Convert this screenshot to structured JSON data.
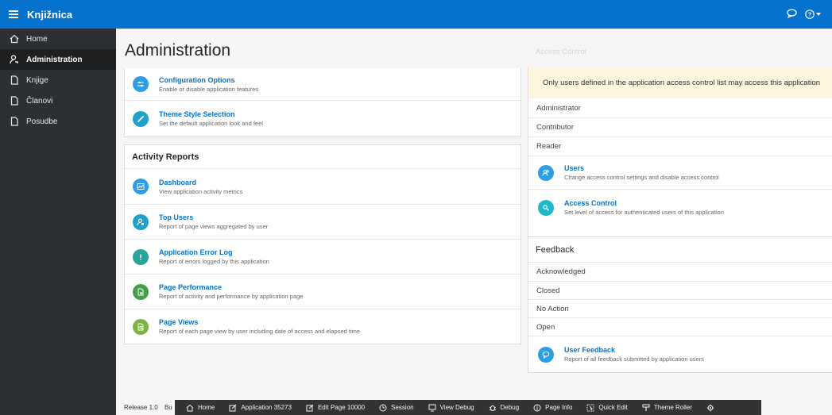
{
  "header": {
    "app_title": "Knjižnica",
    "menu_icon": "hamburger-icon",
    "chat_icon": "speech-bubble-icon",
    "help_icon": "help-icon"
  },
  "sidebar": {
    "items": [
      {
        "label": "Home",
        "icon": "home-icon"
      },
      {
        "label": "Administration",
        "icon": "user-key-icon"
      },
      {
        "label": "Knjige",
        "icon": "page-icon"
      },
      {
        "label": "Članovi",
        "icon": "page-icon"
      },
      {
        "label": "Posudbe",
        "icon": "page-icon"
      }
    ]
  },
  "main": {
    "page_title": "Administration",
    "settings_panel": {
      "items": [
        {
          "title": "Configuration Options",
          "desc": "Enable or disable application features",
          "icon": "sliders-icon",
          "color": "#2d9de5"
        },
        {
          "title": "Theme Style Selection",
          "desc": "Set the default application look and feel",
          "icon": "brush-icon",
          "color": "#1fa2c9"
        }
      ]
    },
    "activity_panel": {
      "title": "Activity Reports",
      "items": [
        {
          "title": "Dashboard",
          "desc": "View application activity metrics",
          "icon": "chart-icon",
          "color": "#2d9de5"
        },
        {
          "title": "Top Users",
          "desc": "Report of page views aggregated by user",
          "icon": "user-icon",
          "color": "#1fa2c9"
        },
        {
          "title": "Application Error Log",
          "desc": "Report of errors logged by this application",
          "icon": "exclamation-icon",
          "color": "#26a69a"
        },
        {
          "title": "Page Performance",
          "desc": "Report of activity and performance by application page",
          "icon": "page-gear-icon",
          "color": "#43a047"
        },
        {
          "title": "Page Views",
          "desc": "Report of each page view by user including date of access and elapsed time",
          "icon": "page-search-icon",
          "color": "#7cb342"
        }
      ]
    },
    "access_panel": {
      "title": "Access Control",
      "notice": "Only users defined in the application access control list may access this application",
      "roles": [
        "Administrator",
        "Contributor",
        "Reader"
      ],
      "items": [
        {
          "title": "Users",
          "desc": "Change access control settings and disable access control",
          "icon": "users-icon",
          "color": "#2d9de5"
        },
        {
          "title": "Access Control",
          "desc": "Set level of access for authenticated users of this application",
          "icon": "key-icon",
          "color": "#1fb8c9"
        }
      ]
    },
    "feedback_panel": {
      "title": "Feedback",
      "statuses": [
        "Acknowledged",
        "Closed",
        "No Action",
        "Open"
      ],
      "item": {
        "title": "User Feedback",
        "desc": "Report of all feedback submitted by application users",
        "icon": "comment-icon",
        "color": "#2d9de5"
      }
    }
  },
  "footer": {
    "release": "Release 1.0",
    "partial": "Bu"
  },
  "devbar": {
    "items": [
      {
        "label": "Home",
        "icon": "home-icon"
      },
      {
        "label": "Application 35273",
        "icon": "edit-icon"
      },
      {
        "label": "Edit Page 10000",
        "icon": "edit-icon"
      },
      {
        "label": "Session",
        "icon": "clock-icon"
      },
      {
        "label": "View Debug",
        "icon": "debug-view-icon"
      },
      {
        "label": "Debug",
        "icon": "bug-icon"
      },
      {
        "label": "Page Info",
        "icon": "info-icon"
      },
      {
        "label": "Quick Edit",
        "icon": "cursor-icon"
      },
      {
        "label": "Theme Roller",
        "icon": "roller-icon"
      },
      {
        "label": "",
        "icon": "gear-icon"
      }
    ]
  }
}
